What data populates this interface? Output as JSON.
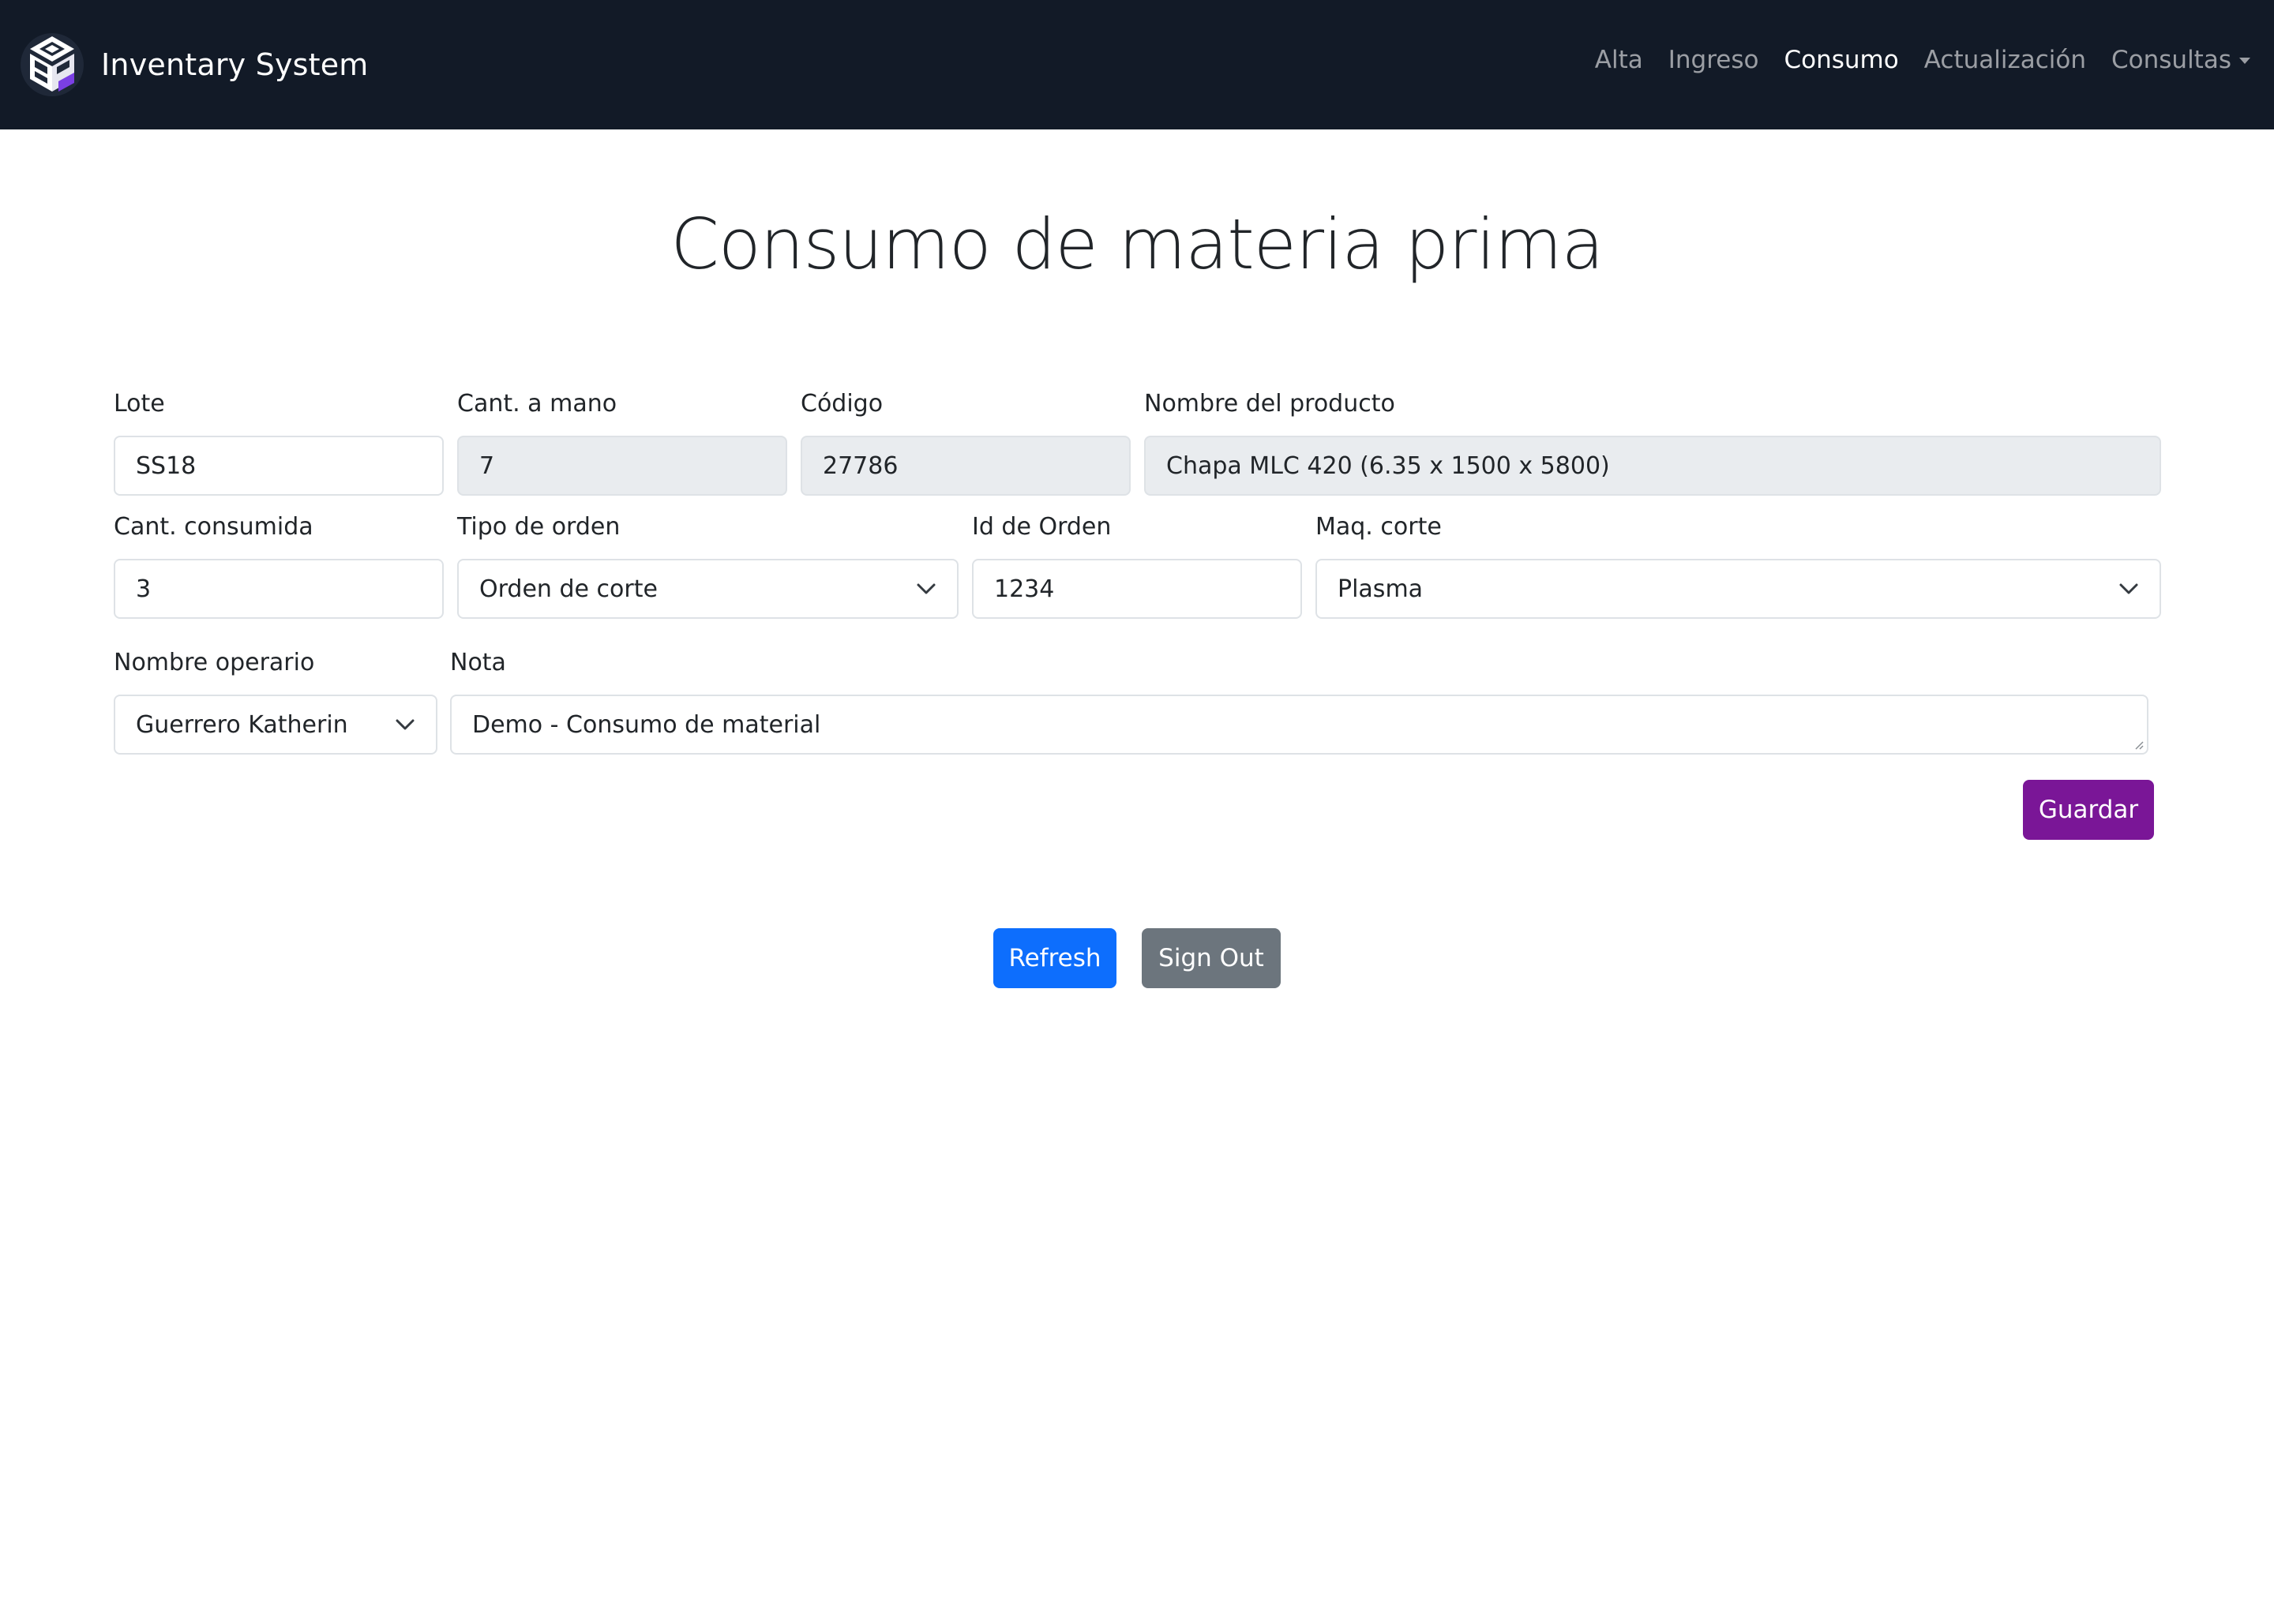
{
  "navbar": {
    "brand": "Inventary System",
    "links": [
      {
        "label": "Alta",
        "active": false
      },
      {
        "label": "Ingreso",
        "active": false
      },
      {
        "label": "Consumo",
        "active": true
      },
      {
        "label": "Actualización",
        "active": false
      },
      {
        "label": "Consultas",
        "active": false,
        "dropdown": true
      }
    ]
  },
  "page": {
    "title": "Consumo de materia prima"
  },
  "form": {
    "lote": {
      "label": "Lote",
      "value": "SS18"
    },
    "cant_a_mano": {
      "label": "Cant. a mano",
      "value": "7"
    },
    "codigo": {
      "label": "Código",
      "value": "27786"
    },
    "nombre_producto": {
      "label": "Nombre del producto",
      "value": "Chapa MLC 420 (6.35 x 1500 x 5800)"
    },
    "cant_consumida": {
      "label": "Cant. consumida",
      "value": "3"
    },
    "tipo_orden": {
      "label": "Tipo de orden",
      "value": "Orden de corte"
    },
    "id_orden": {
      "label": "Id de Orden",
      "value": "1234"
    },
    "maq_corte": {
      "label": "Maq. corte",
      "value": "Plasma"
    },
    "nombre_operario": {
      "label": "Nombre operario",
      "value": "Guerrero Katherin"
    },
    "nota": {
      "label": "Nota",
      "value": "Demo -  Consumo de material"
    }
  },
  "buttons": {
    "guardar": "Guardar",
    "refresh": "Refresh",
    "sign_out": "Sign Out"
  },
  "colors": {
    "navbar_bg": "#121a27",
    "guardar": "#7a1697",
    "refresh": "#0d6efd",
    "sign_out": "#6c757d",
    "disabled_field": "#e9ecef"
  },
  "icons": {
    "brand": "cube-logo-icon",
    "select": "chevron-down-icon",
    "dropdown": "caret-down-icon"
  }
}
